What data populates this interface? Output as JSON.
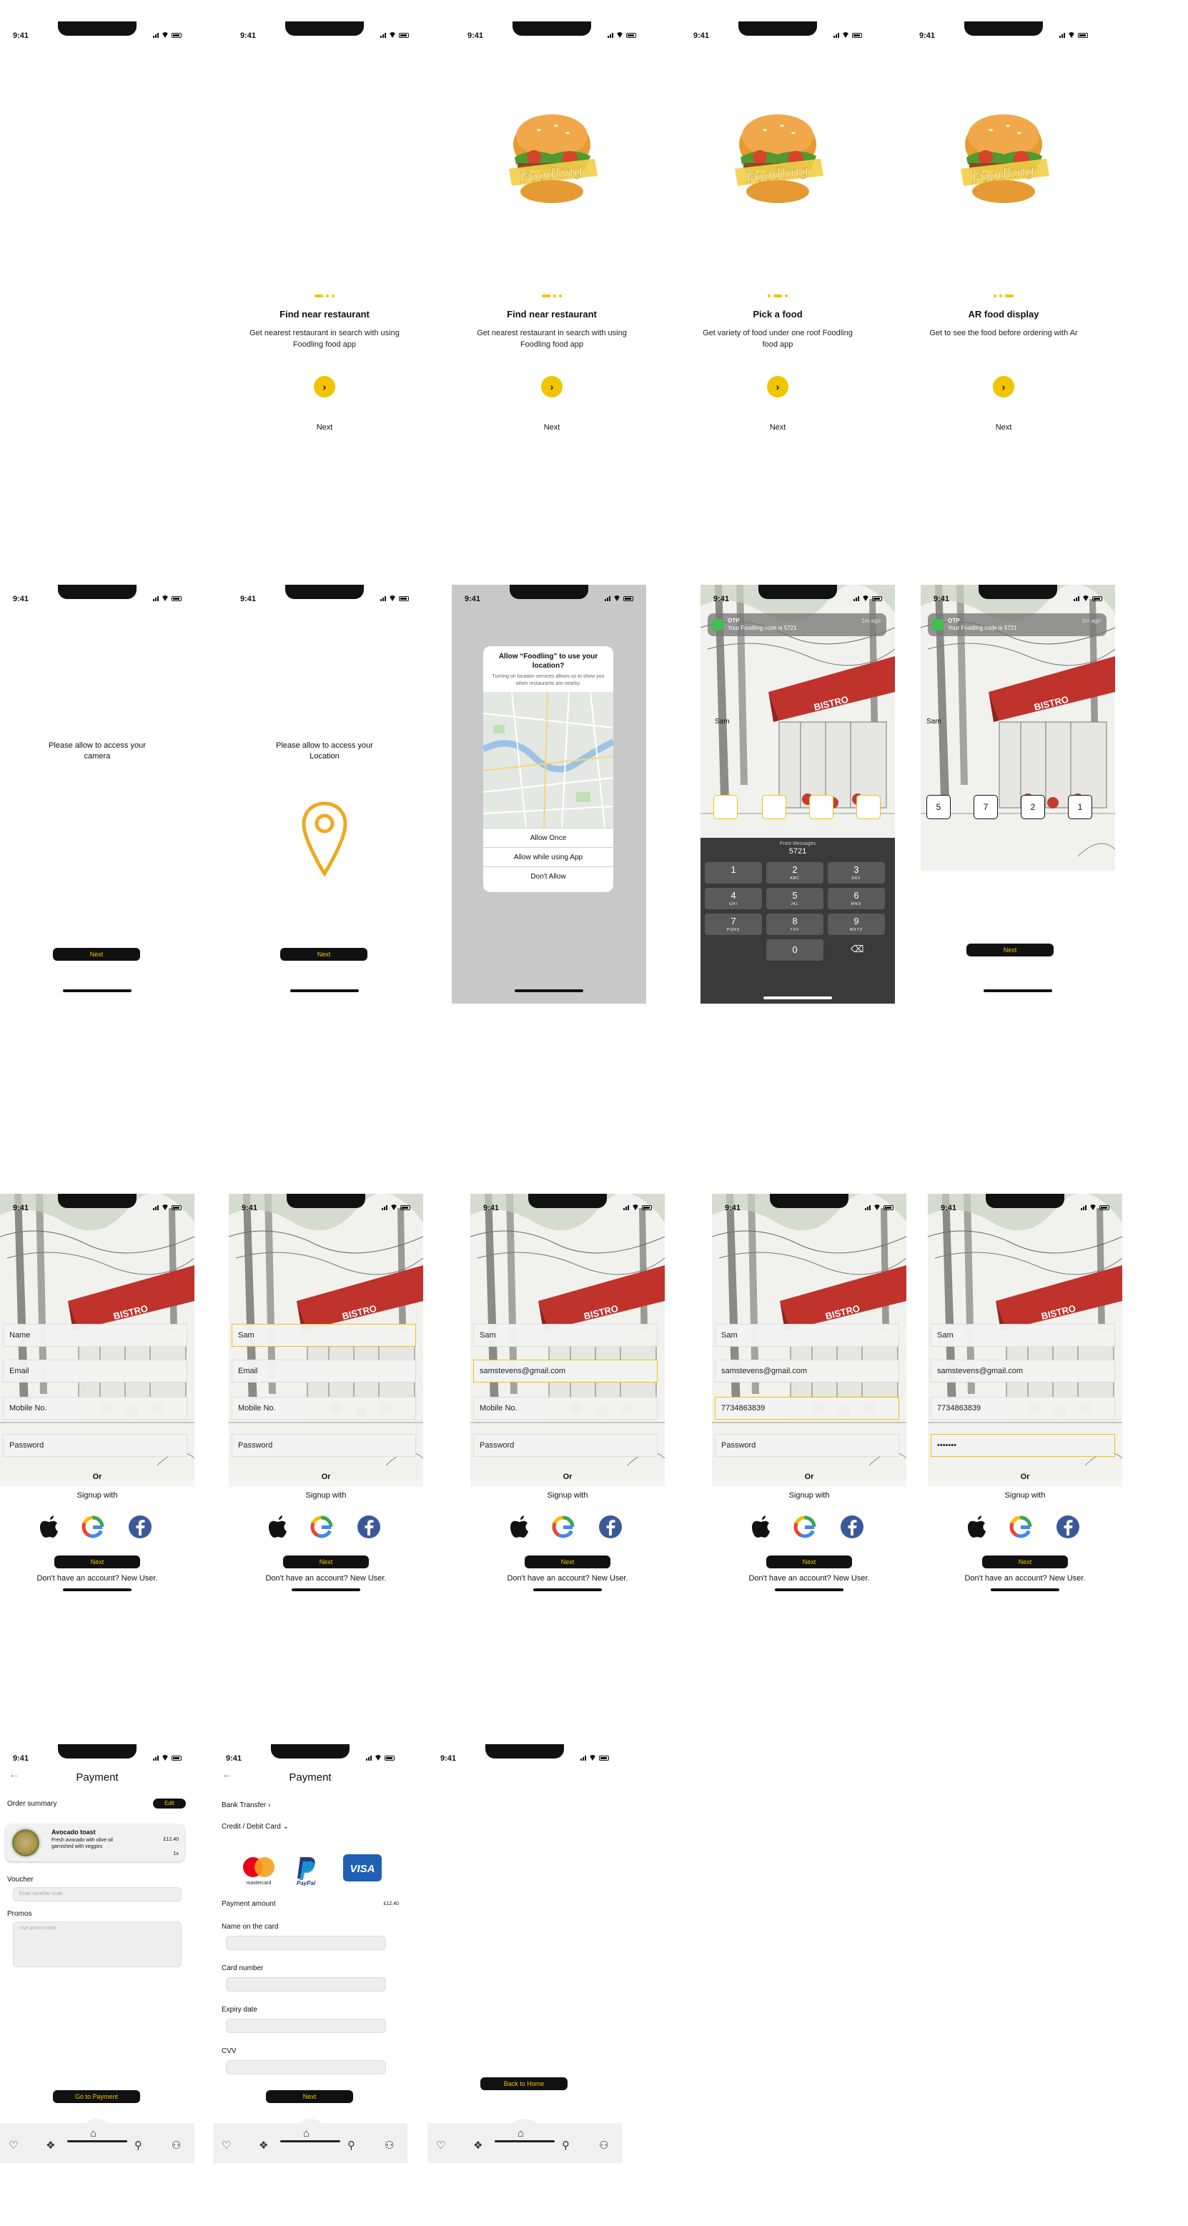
{
  "status": {
    "time": "9:41"
  },
  "onboarding": [
    {
      "title": "",
      "desc": "",
      "next": ""
    },
    {
      "title": "Find near restaurant",
      "desc": "Get nearest restaurant in search  with using Foodling food app",
      "next": "Next"
    },
    {
      "title": "Find near restaurant",
      "desc": "Get nearest restaurant in search  with using Foodling food app",
      "next": "Next"
    },
    {
      "title": "Pick a food",
      "desc": "Get variety of food under one roof Foodling food app",
      "next": "Next"
    },
    {
      "title": "AR food display",
      "desc": "Get to see the food before ordering with Ar",
      "next": "Next"
    }
  ],
  "brand": {
    "logo_text": "Foodling",
    "accent": "#f2c400"
  },
  "permissions": {
    "camera_text": "Please allow to access your camera",
    "location_text": "Please allow to access your Location",
    "next_label": "Next"
  },
  "location_dialog": {
    "title": "Allow “Foodling” to use your location?",
    "subtitle": "Turning on location services allows us to show you when restaurants are nearby.",
    "options": [
      "Allow Once",
      "Allow while using App",
      "Don't Allow"
    ]
  },
  "otp": {
    "notif_app": "OTP",
    "notif_text": "Your Foodling code is 5721",
    "notif_time": "1m ago",
    "scene_label": "Sam",
    "from": "From Messages",
    "code": "5721",
    "digits_filled": [
      "5",
      "7",
      "2",
      "1"
    ],
    "keys": [
      {
        "n": "1",
        "l": ""
      },
      {
        "n": "2",
        "l": "ABC"
      },
      {
        "n": "3",
        "l": "DEF"
      },
      {
        "n": "4",
        "l": "GHI"
      },
      {
        "n": "5",
        "l": "JKL"
      },
      {
        "n": "6",
        "l": "MNO"
      },
      {
        "n": "7",
        "l": "PQRS"
      },
      {
        "n": "8",
        "l": "TUV"
      },
      {
        "n": "9",
        "l": "WXYZ"
      },
      {
        "n": "0",
        "l": ""
      }
    ],
    "next_label": "Next"
  },
  "signup": {
    "placeholders": {
      "name": "Name",
      "email": "Email",
      "mobile": "Mobile No.",
      "password": "Password"
    },
    "values": {
      "name": "Sam",
      "email": "samstevens@gmail.com",
      "mobile": "7734863839",
      "password": "•••••••"
    },
    "or": "Or",
    "signup_with": "Signup with",
    "next_label": "Next",
    "no_account": "Don't have an account? New User."
  },
  "payment1": {
    "title": "Payment",
    "order_summary": "Order summary",
    "edit": "Edit",
    "item_name": "Avocado toast",
    "item_desc": "Fresh avocado with olive oil garnished with veggies",
    "item_price": "£12.40",
    "item_qty": "1x",
    "voucher_label": "Voucher",
    "voucher_placeholder": "Enter voucher code",
    "promos_label": "Promos",
    "promos_placeholder": "Use promo code",
    "cta": "Go to Payment"
  },
  "payment2": {
    "title": "Payment",
    "bank_transfer": "Bank Transfer",
    "card_option": "Credit / Debit Card",
    "card_brands": [
      "mastercard",
      "PayPal",
      "VISA"
    ],
    "amount_label": "Payment amount",
    "amount_value": "£12.40",
    "name_label": "Name on the card",
    "number_label": "Card number",
    "expiry_label": "Expiry date",
    "cvv_label": "CVV",
    "cta": "Next"
  },
  "payment3": {
    "cta": "Back to Home"
  },
  "tabs": [
    "heart-icon",
    "box-icon",
    "home-icon",
    "search-icon",
    "profile-icon"
  ]
}
